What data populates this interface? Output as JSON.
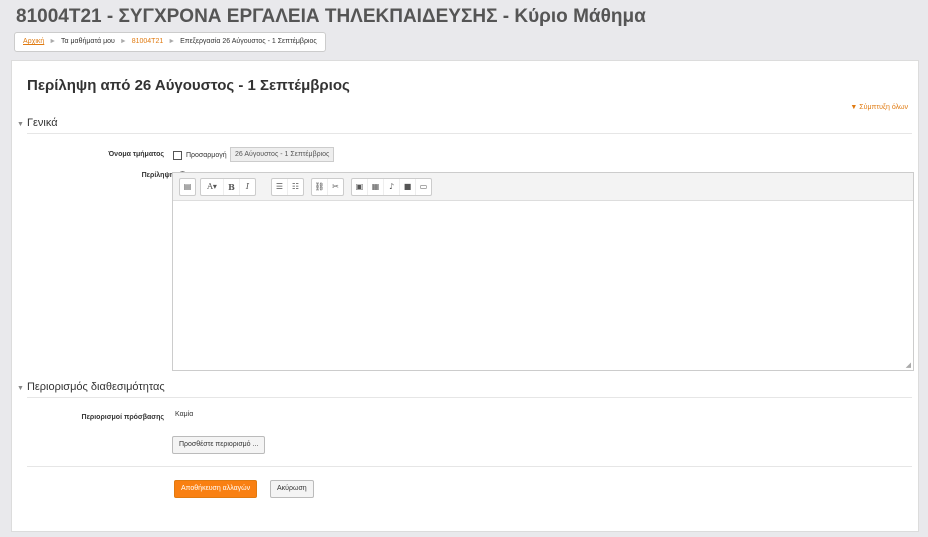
{
  "header": {
    "course_title": "81004T21 - ΣΥΓΧΡΟΝΑ ΕΡΓΑΛΕΙΑ ΤΗΛΕΚΠΑΙΔΕΥΣΗΣ - Κύριο Μάθημα"
  },
  "breadcrumb": {
    "home": "Αρχική",
    "my_courses": "Τα μαθήματά μου",
    "course": "81004T21",
    "current": "Επεξεργασία 26 Αύγουστος - 1 Σεπτέμβριος",
    "separator": "►"
  },
  "page": {
    "heading": "Περίληψη από 26 Αύγουστος - 1 Σεπτέμβριος",
    "expand_all": "▼ Σύμπτυξη όλων"
  },
  "general": {
    "title": "Γενικά",
    "section_name_label": "Όνομα τμήματος",
    "custom_label": "Προσαρμογή",
    "section_name_value": "26 Αύγουστος - 1 Σεπτέμβριος",
    "summary_label": "Περίληψη",
    "help": "?"
  },
  "toolbar": {
    "groups": [
      [
        "▤"
      ],
      [
        "A▾",
        "B",
        "I"
      ],
      [
        "☰",
        "☷"
      ],
      [
        "⛓",
        "✂"
      ],
      [
        "▣",
        "▦",
        "♪",
        "■",
        "▭"
      ]
    ]
  },
  "restrictions": {
    "title": "Περιορισμός διαθεσιμότητας",
    "access_label": "Περιορισμοί πρόσβασης",
    "access_value": "Καμία",
    "add_button": "Προσθέστε περιορισμό ..."
  },
  "actions": {
    "save": "Αποθήκευση αλλαγών",
    "cancel": "Ακύρωση"
  }
}
